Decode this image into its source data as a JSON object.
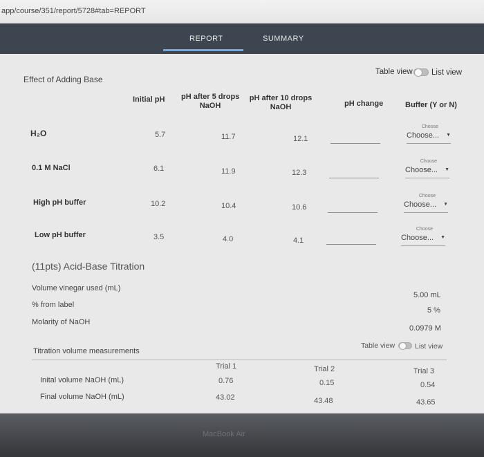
{
  "browser": {
    "url": "app/course/351/report/5728#tab=REPORT"
  },
  "nav": {
    "tab_report": "REPORT",
    "tab_summary": "SUMMARY"
  },
  "base": {
    "section_title": "Effect of Adding Base",
    "view_toggle": {
      "table_label": "Table view",
      "list_label": "List view"
    },
    "headers": {
      "initial_ph": "Initial pH",
      "ph5_line1": "pH after 5 drops",
      "ph5_line2": "NaOH",
      "ph10_line1": "pH after 10 drops",
      "ph10_line2": "NaOH",
      "ph_change": "pH change",
      "buffer": "Buffer (Y or N)"
    },
    "rows": [
      {
        "label": "H₂O",
        "initial": "5.7",
        "after5": "11.7",
        "after10": "12.1",
        "select_placeholder": "Choose",
        "select_value": "Choose..."
      },
      {
        "label": "0.1 M NaCl",
        "initial": "6.1",
        "after5": "11.9",
        "after10": "12.3",
        "select_placeholder": "Choose",
        "select_value": "Choose..."
      },
      {
        "label": "High pH buffer",
        "initial": "10.2",
        "after5": "10.4",
        "after10": "10.6",
        "select_placeholder": "Choose",
        "select_value": "Choose..."
      },
      {
        "label": "Low pH buffer",
        "initial": "3.5",
        "after5": "4.0",
        "after10": "4.1",
        "select_placeholder": "Choose",
        "select_value": "Choose..."
      }
    ]
  },
  "titration": {
    "title": "(11pts) Acid-Base Titration",
    "fields": [
      {
        "label": "Volume vinegar used (mL)",
        "value": "5.00 mL"
      },
      {
        "label": "% from label",
        "value": "5 %"
      },
      {
        "label": "Molarity of NaOH",
        "value": "0.0979 M"
      }
    ],
    "view_toggle": {
      "table_label": "Table view",
      "list_label": "List view"
    },
    "measurements_title": "Titration volume measurements",
    "trial_headers": [
      "Trial 1",
      "Trial 2",
      "Trial 3"
    ],
    "rows": [
      {
        "label": "Inital volume NaOH (mL)",
        "values": [
          "0.76",
          "0.15",
          "0.54"
        ]
      },
      {
        "label": "Final volume NaOH (mL)",
        "values": [
          "43.02",
          "43.48",
          "43.65"
        ]
      }
    ]
  },
  "device": {
    "brand": "MacBook Air"
  }
}
